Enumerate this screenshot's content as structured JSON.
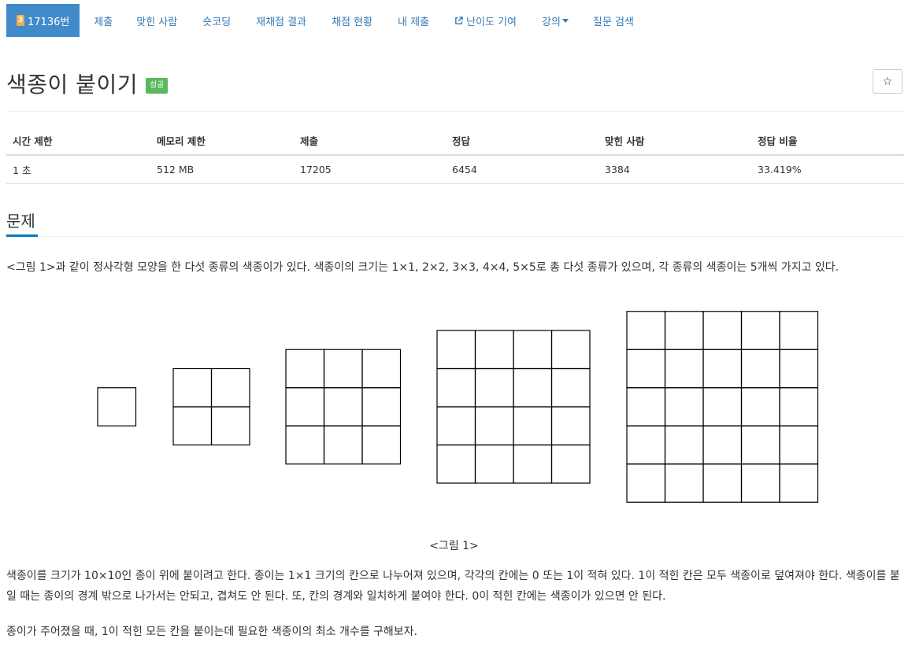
{
  "nav": {
    "problem_number": "17136번",
    "problem_badge": "3",
    "items": [
      {
        "label": "제출"
      },
      {
        "label": "맞힌 사람"
      },
      {
        "label": "숏코딩"
      },
      {
        "label": "재채점 결과"
      },
      {
        "label": "채점 현황"
      },
      {
        "label": "내 제출"
      },
      {
        "label": "난이도 기여"
      },
      {
        "label": "강의"
      },
      {
        "label": "질문 검색"
      }
    ]
  },
  "header": {
    "title": "색종이 붙이기",
    "status": "성공",
    "star": "☆"
  },
  "info": {
    "headers": [
      "시간 제한",
      "메모리 제한",
      "제출",
      "정답",
      "맞힌 사람",
      "정답 비율"
    ],
    "values": [
      "1 초",
      "512 MB",
      "17205",
      "6454",
      "3384",
      "33.419%"
    ]
  },
  "problem": {
    "section_title": "문제",
    "p1": "<그림 1>과 같이 정사각형 모양을 한 다섯 종류의 색종이가 있다. 색종이의 크기는 1×1, 2×2, 3×3, 4×4, 5×5로 총 다섯 종류가 있으며, 각 종류의 색종이는 5개씩 가지고 있다.",
    "figure_caption": "<그림 1>",
    "p2": "색종이를 크기가 10×10인 종이 위에 붙이려고 한다. 종이는 1×1 크기의 칸으로 나누어져 있으며, 각각의 칸에는 0 또는 1이 적혀 있다. 1이 적힌 칸은 모두 색종이로 덮여져야 한다. 색종이를 붙일 때는 종이의 경계 밖으로 나가서는 안되고, 겹쳐도 안 된다. 또, 칸의 경계와 일치하게 붙여야 한다. 0이 적힌 칸에는 색종이가 있으면 안 된다.",
    "p3": "종이가 주어졌을 때, 1이 적힌 모든 칸을 붙이는데 필요한 색종이의 최소 개수를 구해보자."
  },
  "figure": {
    "grid_sizes": [
      1,
      2,
      3,
      4,
      5
    ]
  }
}
